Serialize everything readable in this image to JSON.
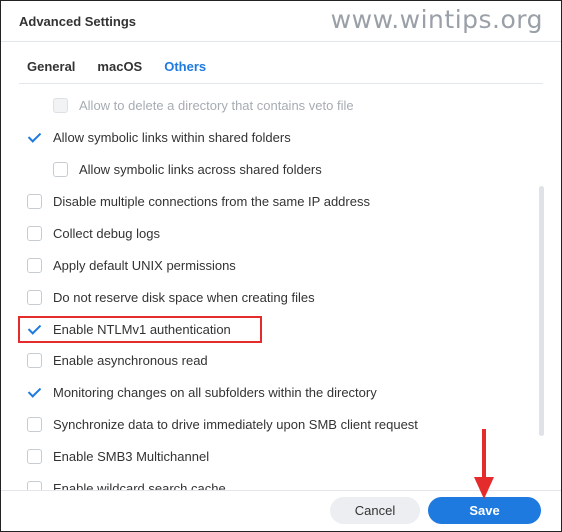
{
  "window": {
    "title": "Advanced Settings"
  },
  "watermark": "www.wintips.org",
  "tabs": [
    {
      "label": "General"
    },
    {
      "label": "macOS"
    },
    {
      "label": "Others"
    }
  ],
  "active_tab": "Others",
  "options": [
    {
      "label": "Allow to delete a directory that contains veto file",
      "checked": false,
      "disabled": true,
      "indent": true
    },
    {
      "label": "Allow symbolic links within shared folders",
      "checked": true,
      "disabled": false,
      "indent": false
    },
    {
      "label": "Allow symbolic links across shared folders",
      "checked": false,
      "disabled": false,
      "indent": true
    },
    {
      "label": "Disable multiple connections from the same IP address",
      "checked": false,
      "disabled": false,
      "indent": false
    },
    {
      "label": "Collect debug logs",
      "checked": false,
      "disabled": false,
      "indent": false
    },
    {
      "label": "Apply default UNIX permissions",
      "checked": false,
      "disabled": false,
      "indent": false
    },
    {
      "label": "Do not reserve disk space when creating files",
      "checked": false,
      "disabled": false,
      "indent": false
    },
    {
      "label": "Enable NTLMv1 authentication",
      "checked": true,
      "disabled": false,
      "indent": false
    },
    {
      "label": "Enable asynchronous read",
      "checked": false,
      "disabled": false,
      "indent": false
    },
    {
      "label": "Monitoring changes on all subfolders within the directory",
      "checked": true,
      "disabled": false,
      "indent": false
    },
    {
      "label": "Synchronize data to drive immediately upon SMB client request",
      "checked": false,
      "disabled": false,
      "indent": false
    },
    {
      "label": "Enable SMB3 Multichannel",
      "checked": false,
      "disabled": false,
      "indent": false
    },
    {
      "label": "Enable wildcard search cache",
      "checked": false,
      "disabled": false,
      "indent": false
    }
  ],
  "footer": {
    "cancel_label": "Cancel",
    "save_label": "Save"
  },
  "colors": {
    "accent": "#1f7ae0",
    "highlight": "#e52c2c",
    "text": "#333333"
  }
}
